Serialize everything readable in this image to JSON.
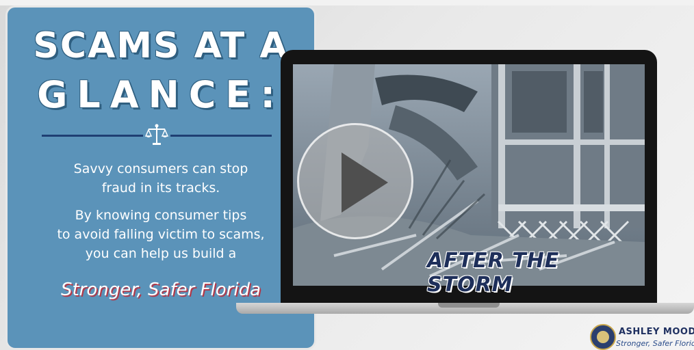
{
  "card": {
    "title_line1": "SCAMS AT A",
    "title_line2": "GLANCE:",
    "paragraph1_line1": "Savvy consumers can stop",
    "paragraph1_line2": "fraud in its tracks.",
    "paragraph2_line1": "By knowing consumer tips",
    "paragraph2_line2": "to avoid falling victim to scams,",
    "paragraph2_line3": "you can help us build a",
    "tagline": "Stronger, Safer Florida",
    "divider_icon": "scales-of-justice-icon"
  },
  "video": {
    "caption": "AFTER THE STORM",
    "play_icon": "play-icon"
  },
  "logo": {
    "name": "ASHLEY MOODY",
    "tagline": "Stronger, Safer Florida",
    "seal_icon": "attorney-general-seal-icon"
  },
  "colors": {
    "card_blue": "#5b93b9",
    "divider_navy": "#1f3f73",
    "caption_navy": "#1e2f5a",
    "tagline_shadow_red": "#b23a4a"
  }
}
